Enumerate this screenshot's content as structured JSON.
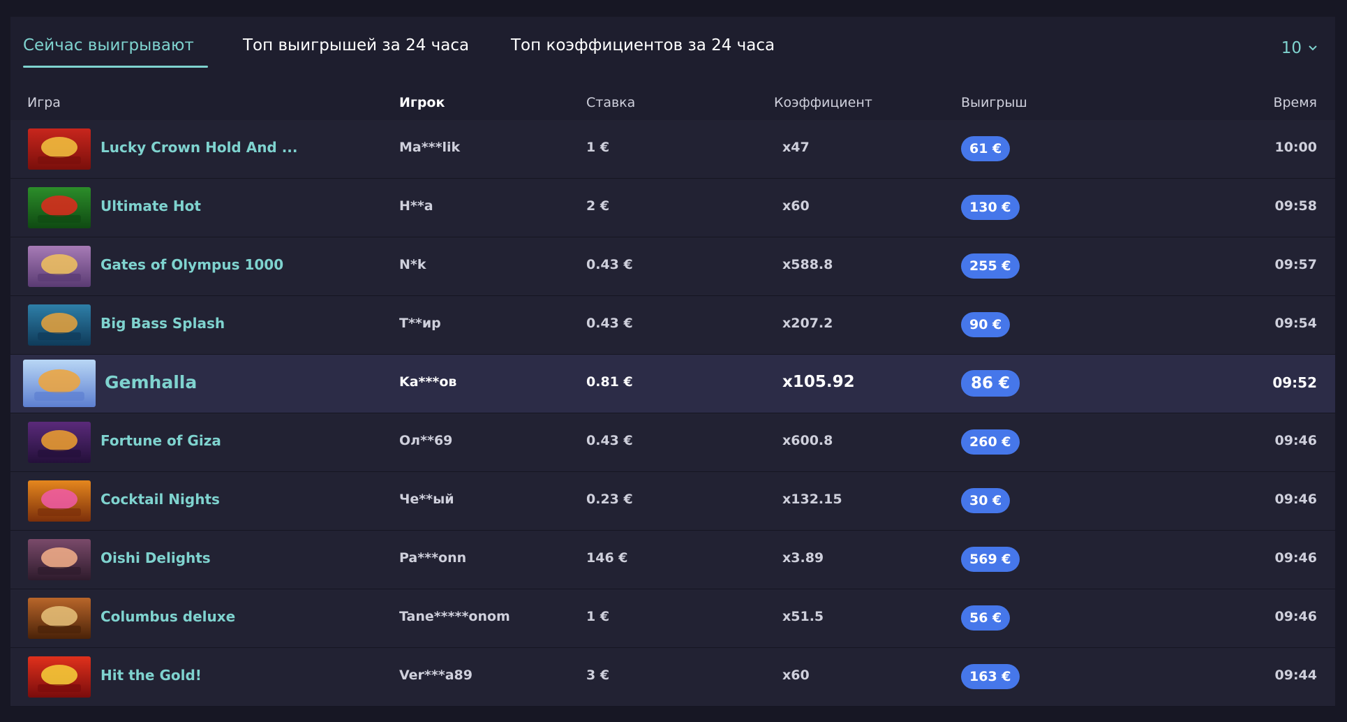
{
  "tabs": [
    {
      "label": "Сейчас выигрывают",
      "active": true
    },
    {
      "label": "Топ выигрышей за 24 часа",
      "active": false
    },
    {
      "label": "Топ коэффициентов за 24 часа",
      "active": false
    }
  ],
  "page_size": {
    "value": "10",
    "icon": "chevron-down-icon"
  },
  "columns": {
    "game": "Игра",
    "player": "Игрок",
    "bet": "Ставка",
    "coef": "Коэффициент",
    "win": "Выигрыш",
    "time": "Время"
  },
  "colors": {
    "accent": "#7fd3cf",
    "win_badge": "#4677ea",
    "background": "#1e1e2e",
    "highlight_row": "#2c2c47"
  },
  "highlighted_row": 4,
  "rows": [
    {
      "game": "Lucky Crown Hold And ...",
      "player": "Ma***lik",
      "bet": "1 €",
      "coef": "x47",
      "win": "61 €",
      "time": "10:00",
      "thumb_colors": [
        "#c8261d",
        "#7a0f0b",
        "#f3c640"
      ]
    },
    {
      "game": "Ultimate Hot",
      "player": "H**a",
      "bet": "2 €",
      "coef": "x60",
      "win": "130 €",
      "time": "09:58",
      "thumb_colors": [
        "#2c8d2a",
        "#0f4a12",
        "#e0291d"
      ]
    },
    {
      "game": "Gates of Olympus 1000",
      "player": "N*k",
      "bet": "0.43 €",
      "coef": "x588.8",
      "win": "255 €",
      "time": "09:57",
      "thumb_colors": [
        "#a77bb6",
        "#5a3b73",
        "#f1c35d"
      ]
    },
    {
      "game": "Big Bass Splash",
      "player": "T**ир",
      "bet": "0.43 €",
      "coef": "x207.2",
      "win": "90 €",
      "time": "09:54",
      "thumb_colors": [
        "#2e7fa8",
        "#0f3b5a",
        "#e9a23b"
      ]
    },
    {
      "game": "Gemhalla",
      "player": "Ka***ов",
      "bet": "0.81 €",
      "coef": "x105.92",
      "win": "86 €",
      "time": "09:52",
      "thumb_colors": [
        "#b9d7f5",
        "#5d7fd1",
        "#f0a43a"
      ]
    },
    {
      "game": "Fortune of Giza",
      "player": "Ол**69",
      "bet": "0.43 €",
      "coef": "x600.8",
      "win": "260 €",
      "time": "09:46",
      "thumb_colors": [
        "#5a2a7a",
        "#24103a",
        "#f0a12f"
      ]
    },
    {
      "game": "Cocktail Nights",
      "player": "Че**ый",
      "bet": "0.23 €",
      "coef": "x132.15",
      "win": "30 €",
      "time": "09:46",
      "thumb_colors": [
        "#e5871e",
        "#7c2f0a",
        "#f05aa8"
      ]
    },
    {
      "game": "Oishi Delights",
      "player": "Pa***onn",
      "bet": "146 €",
      "coef": "x3.89",
      "win": "569 €",
      "time": "09:46",
      "thumb_colors": [
        "#7a4a6a",
        "#2e1b2c",
        "#f4b089"
      ]
    },
    {
      "game": "Columbus deluxe",
      "player": "Tane*****onom",
      "bet": "1 €",
      "coef": "x51.5",
      "win": "56 €",
      "time": "09:46",
      "thumb_colors": [
        "#b9662a",
        "#4a2208",
        "#e8c27a"
      ]
    },
    {
      "game": "Hit the Gold!",
      "player": "Ver***a89",
      "bet": "3 €",
      "coef": "x60",
      "win": "163 €",
      "time": "09:44",
      "thumb_colors": [
        "#e0311c",
        "#7a0c0c",
        "#f7d23a"
      ]
    }
  ]
}
